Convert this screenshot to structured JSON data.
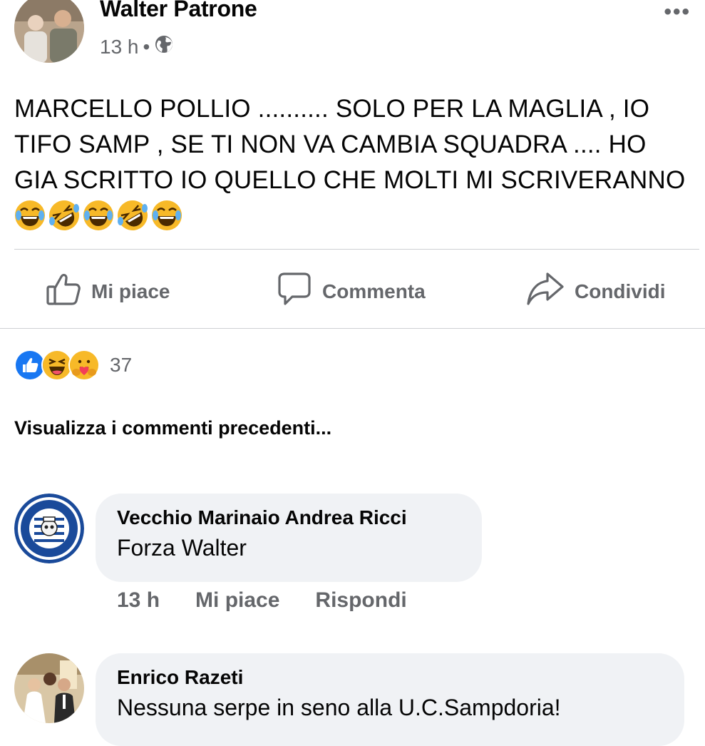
{
  "post": {
    "author": "Walter Patrone",
    "time": "13 h",
    "separator": "•",
    "text": "MARCELLO POLLIO .......... SOLO PER LA MAGLIA , IO TIFO SAMP , SE TI NON VA CAMBIA SQUADRA .... HO GIA SCRITTO IO QUELLO CHE MOLTI MI SCRIVERANNO",
    "emojis": [
      "tears-of-joy-emoji",
      "rofl-emoji",
      "tears-of-joy-emoji",
      "rofl-emoji",
      "tears-of-joy-emoji"
    ]
  },
  "actions": {
    "like": "Mi piace",
    "comment": "Commenta",
    "share": "Condividi"
  },
  "reactions": {
    "icons": [
      "like-reaction-icon",
      "haha-reaction-icon",
      "care-reaction-icon"
    ],
    "count": "37"
  },
  "comments_section": {
    "view_previous": "Visualizza i commenti precedenti..."
  },
  "comments": [
    {
      "author": "Vecchio Marinaio Andrea Ricci",
      "text": "Forza Walter",
      "time": "13 h",
      "like": "Mi piace",
      "reply": "Rispondi"
    },
    {
      "author": "Enrico Razeti",
      "text": "Nessuna serpe in seno alla U.C.Sampdoria!"
    }
  ],
  "colors": {
    "text_primary": "#050505",
    "text_secondary": "#65676b",
    "bubble": "#f0f2f5",
    "like_blue": "#1877f2",
    "emoji_yellow": "#f7b928"
  }
}
